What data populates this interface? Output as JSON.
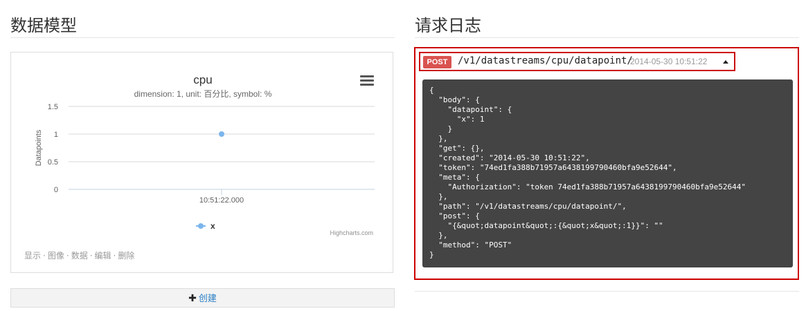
{
  "left": {
    "heading": "数据模型",
    "chart_card": {
      "actions": [
        "显示",
        "图像",
        "数据",
        "编辑",
        "删除"
      ],
      "actions_separator": "·"
    },
    "create_button": {
      "icon": "plus-icon",
      "label": "创建"
    }
  },
  "right": {
    "heading": "请求日志",
    "log": {
      "method": "POST",
      "path": "/v1/datastreams/cpu/datapoint/",
      "timestamp": "2014-05-30 10:51:22",
      "toggle_icon": "caret-up-icon",
      "body": "{\n  \"body\": {\n    \"datapoint\": {\n      \"x\": 1\n    }\n  },\n  \"get\": {},\n  \"created\": \"2014-05-30 10:51:22\",\n  \"token\": \"74ed1fa388b71957a6438199790460bfa9e52644\",\n  \"meta\": {\n    \"Authorization\": \"token 74ed1fa388b71957a6438199790460bfa9e52644\"\n  },\n  \"path\": \"/v1/datastreams/cpu/datapoint/\",\n  \"post\": {\n    \"{&quot;datapoint&quot;:{&quot;x&quot;:1}}\": \"\"\n  },\n  \"method\": \"POST\"\n}"
    }
  },
  "colors": {
    "series": "#7cb5ec",
    "highlight_border": "#cc0000",
    "post_badge": "#d9534f",
    "code_bg": "#444444",
    "link": "#2a7fc4"
  },
  "chart_data": {
    "type": "line",
    "title": "cpu",
    "subtitle": "dimension: 1, unit: 百分比, symbol: %",
    "ylabel": "Datapoints",
    "xlabel": "",
    "x_categories": [
      "10:51:22.000"
    ],
    "y_ticks": [
      "0",
      "0.5",
      "1",
      "1.5"
    ],
    "ylim": [
      0,
      1.5
    ],
    "grid": true,
    "series": [
      {
        "name": "x",
        "x": [
          "10:51:22.000"
        ],
        "values": [
          1
        ],
        "color": "#7cb5ec"
      }
    ],
    "legend": {
      "position": "bottom-center"
    },
    "credits": "Highcharts.com",
    "menu_icon": "hamburger-menu-icon"
  }
}
